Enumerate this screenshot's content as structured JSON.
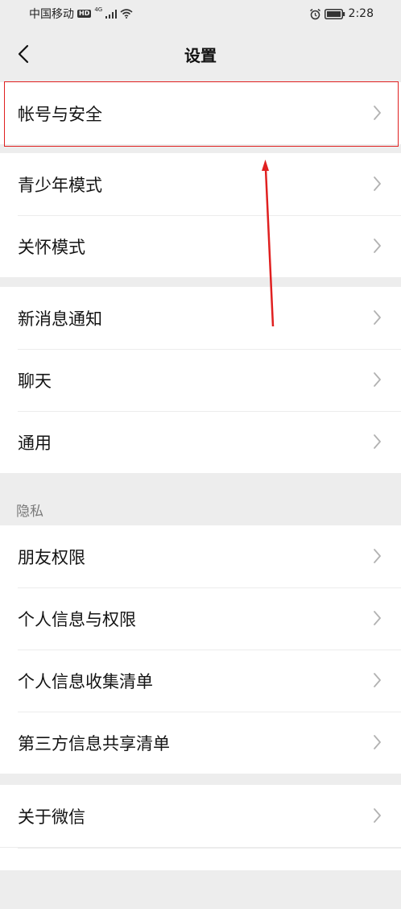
{
  "status_bar": {
    "carrier": "中国移动",
    "hd_badge": "HD",
    "network": "4G",
    "time": "2:28",
    "icons": [
      "hd-badge",
      "signal-icon",
      "wifi-icon",
      "alarm-icon",
      "battery-icon"
    ]
  },
  "header": {
    "title": "设置",
    "back_icon": "chevron-left-icon"
  },
  "groups": [
    {
      "items": [
        {
          "label": "帐号与安全"
        }
      ]
    },
    {
      "items": [
        {
          "label": "青少年模式"
        },
        {
          "label": "关怀模式"
        }
      ]
    },
    {
      "items": [
        {
          "label": "新消息通知"
        },
        {
          "label": "聊天"
        },
        {
          "label": "通用"
        }
      ]
    },
    {
      "section_title": "隐私",
      "items": [
        {
          "label": "朋友权限"
        },
        {
          "label": "个人信息与权限"
        },
        {
          "label": "个人信息收集清单"
        },
        {
          "label": "第三方信息共享清单"
        }
      ]
    },
    {
      "items": [
        {
          "label": "关于微信"
        }
      ]
    }
  ],
  "annotation": {
    "highlight_color": "#e02020",
    "highlighted_item": "帐号与安全"
  },
  "colors": {
    "background": "#ededed",
    "cell": "#ffffff",
    "chevron": "#b2b2b2"
  }
}
